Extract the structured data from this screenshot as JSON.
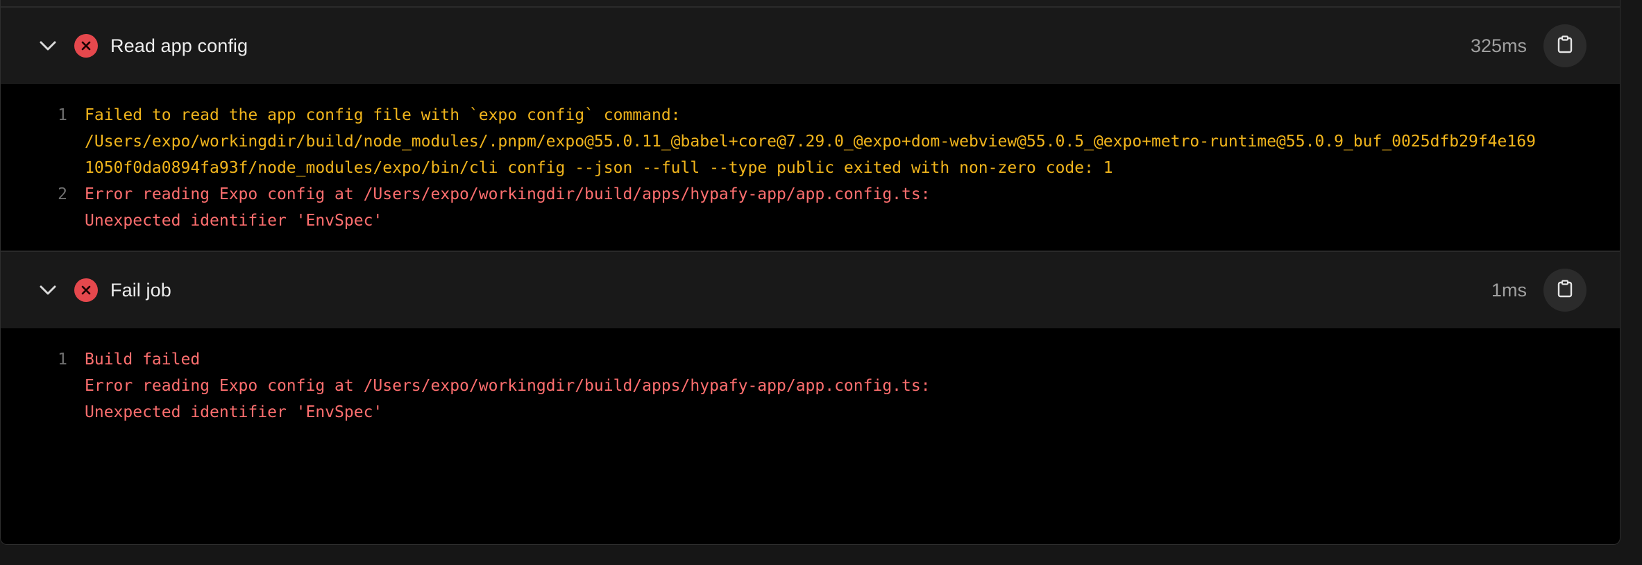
{
  "steps": [
    {
      "title": "Read app config",
      "duration": "325ms",
      "log": [
        {
          "no": "1",
          "text": "Failed to read the app config file with `expo config` command:",
          "level": "warn"
        },
        {
          "no": "",
          "text": "/Users/expo/workingdir/build/node_modules/.pnpm/expo@55.0.11_@babel+core@7.29.0_@expo+dom-webview@55.0.5_@expo+metro-runtime@55.0.9_buf_0025dfb29f4e169",
          "level": "warn"
        },
        {
          "no": "",
          "text": "1050f0da0894fa93f/node_modules/expo/bin/cli config --json --full --type public exited with non-zero code: 1",
          "level": "warn"
        },
        {
          "no": "2",
          "text": "Error reading Expo config at /Users/expo/workingdir/build/apps/hypafy-app/app.config.ts:",
          "level": "err"
        },
        {
          "no": "",
          "text": "",
          "level": "err"
        },
        {
          "no": "",
          "text": "Unexpected identifier 'EnvSpec'",
          "level": "err"
        }
      ]
    },
    {
      "title": "Fail job",
      "duration": "1ms",
      "log": [
        {
          "no": "1",
          "text": "Build failed",
          "level": "err"
        },
        {
          "no": "",
          "text": "",
          "level": "err"
        },
        {
          "no": "",
          "text": "Error reading Expo config at /Users/expo/workingdir/build/apps/hypafy-app/app.config.ts:",
          "level": "err"
        },
        {
          "no": "",
          "text": "",
          "level": "err"
        },
        {
          "no": "",
          "text": "Unexpected identifier 'EnvSpec'",
          "level": "err"
        }
      ]
    }
  ],
  "icons": {
    "toggle": "chevron-down-icon",
    "status": "error-x-icon",
    "copy": "clipboard-icon"
  },
  "colors": {
    "warning_text": "#f1b51c",
    "error_text": "#ff6f6f",
    "status_error": "#e5484d"
  }
}
